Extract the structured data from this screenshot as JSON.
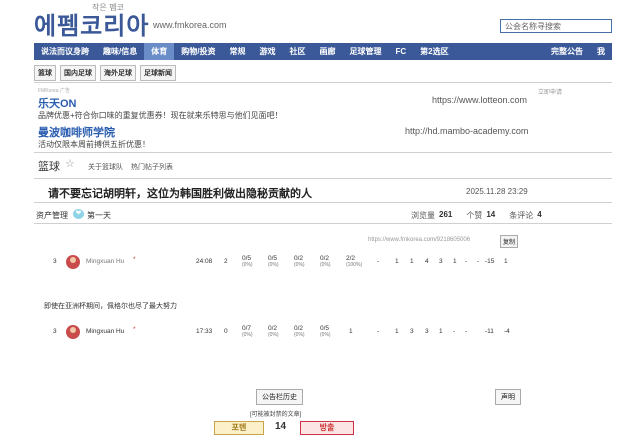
{
  "header": {
    "logo": "에펨코리아",
    "logo_small": "작은 펨코",
    "logo_url": "www.fmkorea.com",
    "search_placeholder": "公会名称寻搜索"
  },
  "nav": {
    "items": [
      "说法而议身跨",
      "趣味/信息",
      "体育",
      "购物/投资",
      "常规",
      "游戏",
      "社区",
      "画廊",
      "足球管理",
      "FC",
      "第2选区"
    ],
    "active_index": 2,
    "right": "完整公告",
    "right2": "我"
  },
  "subnav": [
    "篮球",
    "国内足球",
    "海外足球",
    "足球新闻"
  ],
  "ads": {
    "label": "立即申请",
    "tiny": "FMKorea 广告",
    "items": [
      {
        "title": "乐天ON",
        "desc": "品牌优惠+符合你口味的重复优惠券！现在就来乐特思与他们见面吧！",
        "url": "https://www.lotteon.com"
      },
      {
        "title": "曼波咖啡师学院",
        "desc": "活动仅限本周前搏供五折优惠！",
        "url": "http://hd.mambo-academy.com"
      }
    ]
  },
  "board": {
    "title": "篮球",
    "links": [
      "关于篮球队",
      "热门帖子列表"
    ]
  },
  "post": {
    "title": "请不要忘记胡明轩，这位为韩国胜利做出隐秘贡献的人",
    "date": "2025.11.28 23:29",
    "author": "资产管理",
    "author_badge": "❤",
    "author_suffix": "第一天",
    "views_label": "浏览量",
    "views": "261",
    "likes_label": "个赞",
    "likes": "14",
    "comments_label": "条评论",
    "comments": "4",
    "permalink": "https://www.fmkorea.com/9218605006",
    "copy_label": "复制",
    "caption": "即使在亚洲杯期间，佩格尔也尽了最大努力"
  },
  "stat_rows": [
    {
      "num": "3",
      "name": "Mingxuan Hu",
      "mark": "*",
      "min": "24:08",
      "pts": "2",
      "s1": "0/5",
      "s1p": "(0%)",
      "s2": "0/5",
      "s2p": "(0%)",
      "s3": "0/2",
      "s3p": "(0%)",
      "s4": "0/2",
      "s4p": "(0%)",
      "s5": "2/2",
      "s5p": "(100%)",
      "rest": [
        "-",
        "1",
        "1",
        "4",
        "3",
        "1",
        "-",
        "-",
        "-15",
        "1"
      ]
    },
    {
      "num": "3",
      "name": "Mingxuan Hu",
      "mark": "*",
      "min": "17:33",
      "pts": "0",
      "s1": "0/7",
      "s1p": "(0%)",
      "s2": "0/2",
      "s2p": "(0%)",
      "s3": "0/2",
      "s3p": "(0%)",
      "s4": "0/5",
      "s4p": "(0%)",
      "s5": "1",
      "s5p": "",
      "rest": [
        "-",
        "1",
        "3",
        "3",
        "1",
        "-",
        "-",
        "-11",
        "-4"
      ]
    }
  ],
  "footer": {
    "history_label": "公告栏历史",
    "list_label": "声明",
    "hot_note": "[可能被封禁的文章]",
    "vote_up": "포텐",
    "vote_count": "14",
    "vote_down": "방출"
  },
  "colors": {
    "nav_bg": "#3b5998",
    "nav_active": "#6a8cc7",
    "link": "#2a5db0",
    "avatar": "#c94b4b"
  }
}
